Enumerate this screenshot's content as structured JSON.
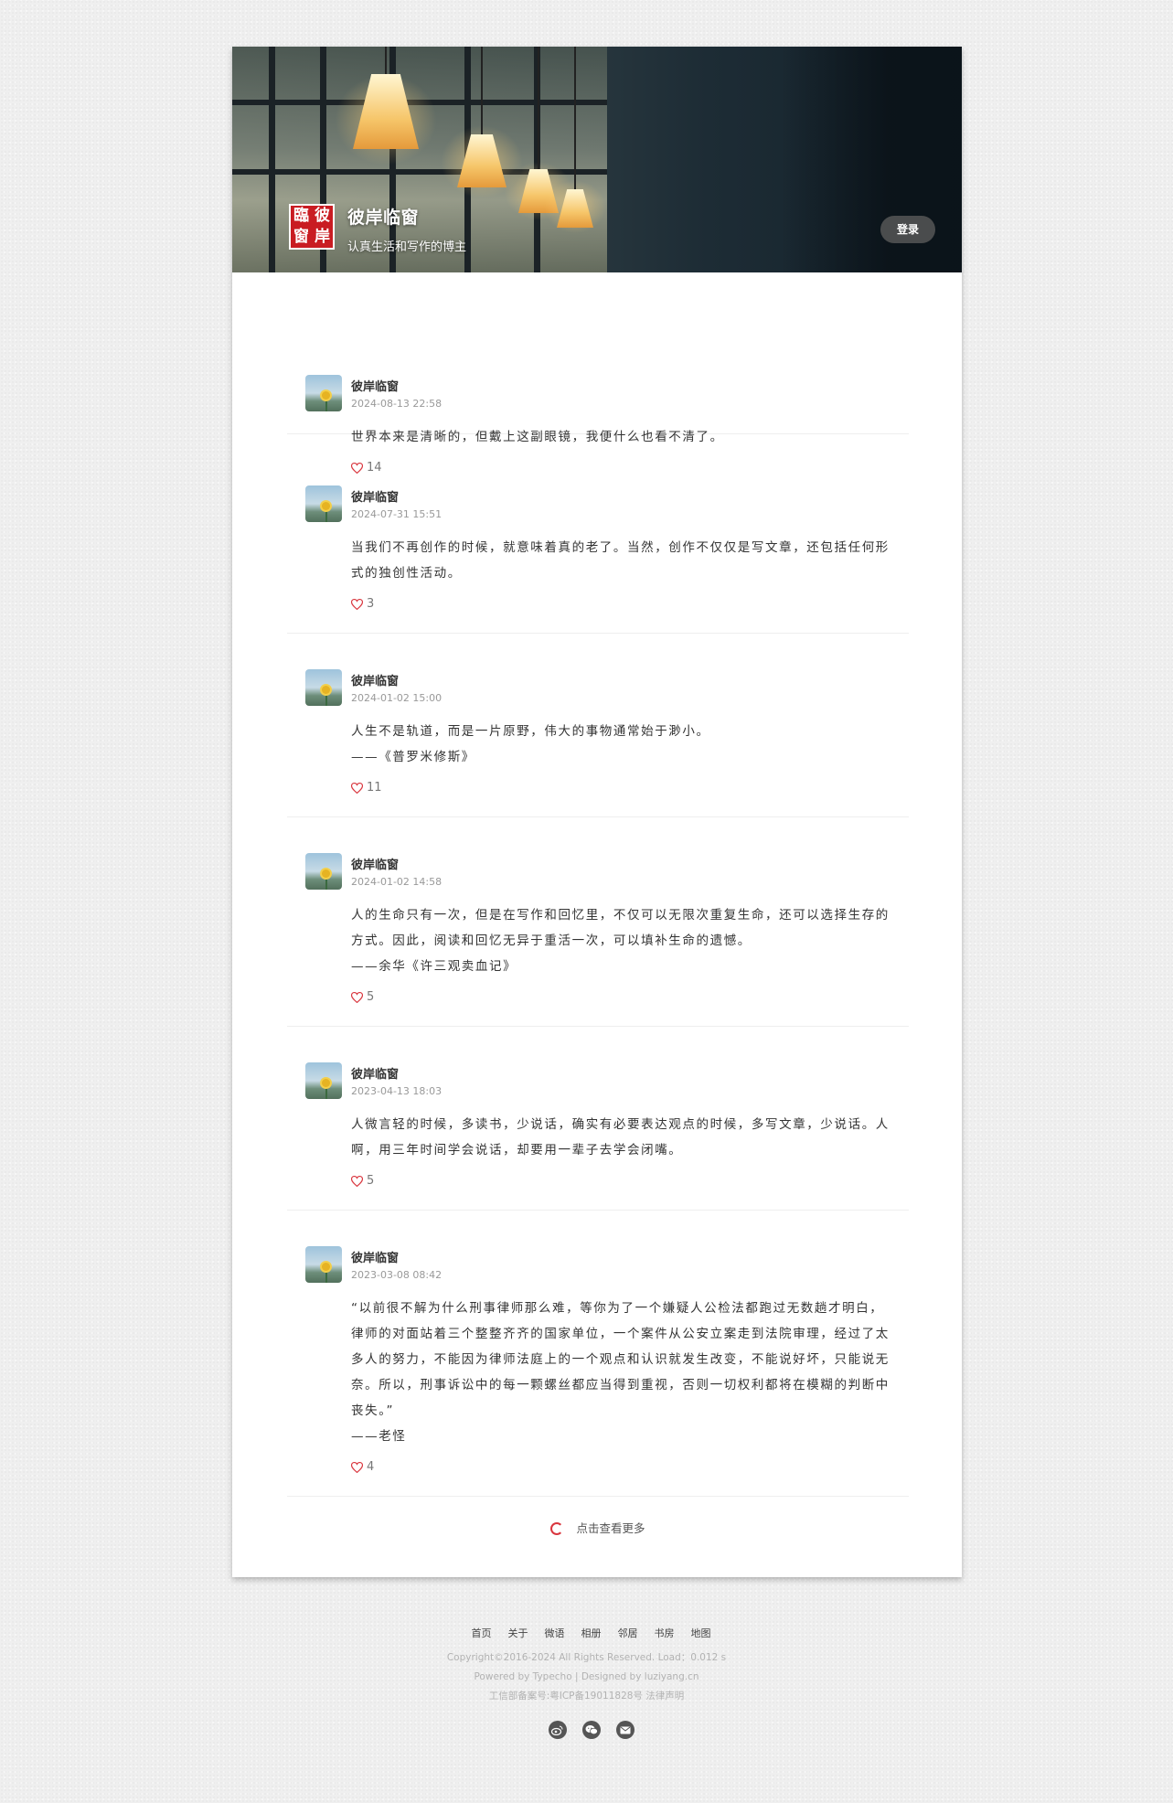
{
  "header": {
    "logo_chars": [
      "臨",
      "彼",
      "窗",
      "岸"
    ],
    "site_title": "彼岸临窗",
    "site_description": "认真生活和写作的博主",
    "login_label": "登录"
  },
  "posts": [
    {
      "author": "彼岸临窗",
      "date": "2024-08-13 22:58",
      "lines": [
        "世界本来是清晰的，但戴上这副眼镜，我便什么也看不清了。"
      ],
      "likes": "14"
    },
    {
      "author": "彼岸临窗",
      "date": "2024-07-31 15:51",
      "lines": [
        "当我们不再创作的时候，就意味着真的老了。当然，创作不仅仅是写文章，还包括任何形式的独创性活动。"
      ],
      "likes": "3"
    },
    {
      "author": "彼岸临窗",
      "date": "2024-01-02 15:00",
      "lines": [
        "人生不是轨道，而是一片原野，伟大的事物通常始于渺小。",
        "——《普罗米修斯》"
      ],
      "likes": "11"
    },
    {
      "author": "彼岸临窗",
      "date": "2024-01-02 14:58",
      "lines": [
        "人的生命只有一次，但是在写作和回忆里，不仅可以无限次重复生命，还可以选择生存的方式。因此，阅读和回忆无异于重活一次，可以填补生命的遗憾。",
        "——余华《许三观卖血记》"
      ],
      "likes": "5"
    },
    {
      "author": "彼岸临窗",
      "date": "2023-04-13 18:03",
      "lines": [
        "人微言轻的时候，多读书，少说话，确实有必要表达观点的时候，多写文章，少说话。人啊，用三年时间学会说话，却要用一辈子去学会闭嘴。"
      ],
      "likes": "5"
    },
    {
      "author": "彼岸临窗",
      "date": "2023-03-08 08:42",
      "lines": [
        "“以前很不解为什么刑事律师那么难，等你为了一个嫌疑人公检法都跑过无数趟才明白，律师的对面站着三个整整齐齐的国家单位，一个案件从公安立案走到法院审理，经过了太多人的努力，不能因为律师法庭上的一个观点和认识就发生改变，不能说好坏，只能说无奈。所以，刑事诉讼中的每一颗螺丝都应当得到重视，否则一切权利都将在模糊的判断中丧失。”",
        "——老怪"
      ],
      "likes": "4"
    }
  ],
  "load_more_label": "点击查看更多",
  "footer": {
    "nav": [
      "首页",
      "关于",
      "微语",
      "相册",
      "邻居",
      "书房",
      "地图"
    ],
    "copyright": "Copyright©2016-2024  All Rights Reserved.  Load：0.012 s",
    "powered": "Powered by Typecho  |  Designed by  luziyang.cn",
    "icp": "工信部备案号:粤ICP备19011828号    法律声明",
    "socials": [
      "weibo-icon",
      "wechat-icon",
      "email-icon"
    ]
  },
  "colors": {
    "accent_red": "#d9363e",
    "logo_red": "#c91c22"
  }
}
